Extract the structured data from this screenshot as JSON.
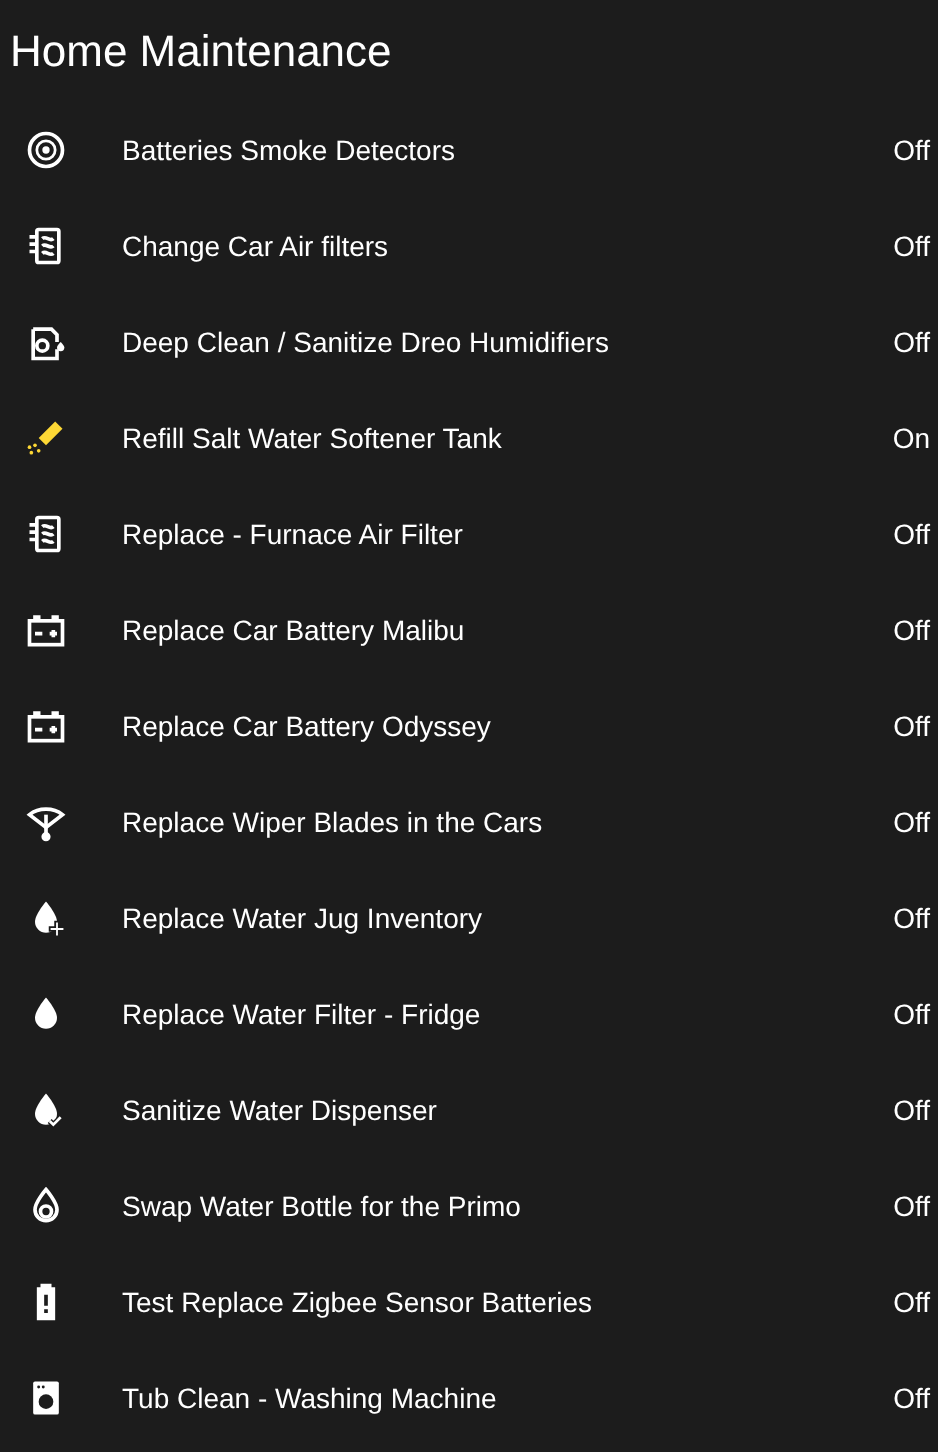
{
  "title": "Home Maintenance",
  "items": [
    {
      "name": "Batteries Smoke Detectors",
      "state": "Off",
      "on": false
    },
    {
      "name": "Change Car Air filters",
      "state": "Off",
      "on": false
    },
    {
      "name": "Deep Clean / Sanitize Dreo Humidifiers",
      "state": "Off",
      "on": false
    },
    {
      "name": "Refill Salt Water Softener Tank",
      "state": "On",
      "on": true
    },
    {
      "name": "Replace - Furnace Air Filter",
      "state": "Off",
      "on": false
    },
    {
      "name": "Replace Car Battery Malibu",
      "state": "Off",
      "on": false
    },
    {
      "name": "Replace Car Battery Odyssey",
      "state": "Off",
      "on": false
    },
    {
      "name": "Replace Wiper Blades in the Cars",
      "state": "Off",
      "on": false
    },
    {
      "name": "Replace Water Jug Inventory",
      "state": "Off",
      "on": false
    },
    {
      "name": "Replace Water Filter - Fridge",
      "state": "Off",
      "on": false
    },
    {
      "name": "Sanitize Water Dispenser",
      "state": "Off",
      "on": false
    },
    {
      "name": "Swap Water Bottle for the Primo",
      "state": "Off",
      "on": false
    },
    {
      "name": "Test Replace Zigbee Sensor Batteries",
      "state": "Off",
      "on": false
    },
    {
      "name": "Tub Clean - Washing Machine",
      "state": "Off",
      "on": false
    }
  ]
}
